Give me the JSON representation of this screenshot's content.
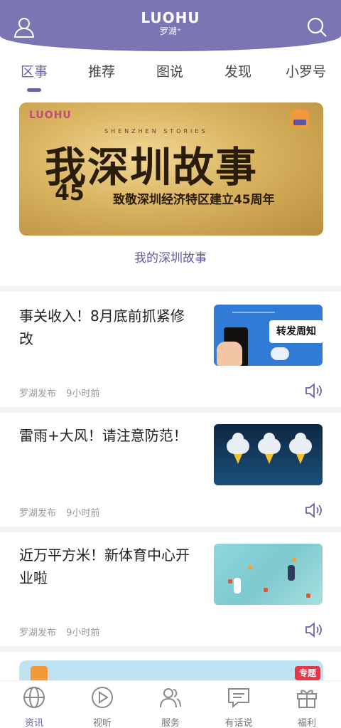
{
  "header": {
    "logo_mark": "LUOHU",
    "logo_sub": "罗湖⁺"
  },
  "tabs": [
    {
      "label": "区事",
      "active": true
    },
    {
      "label": "推荐",
      "active": false
    },
    {
      "label": "图说",
      "active": false
    },
    {
      "label": "发现",
      "active": false
    },
    {
      "label": "小罗号",
      "active": false
    }
  ],
  "banner": {
    "brand": "LUOHU",
    "en_text": "SHENZHEN STORIES",
    "title": "我深圳故事",
    "number": "45",
    "subtitle": "致敬深圳经济特区建立45周年",
    "caption": "我的深圳故事"
  },
  "news": [
    {
      "title": "事关收入！8月底前抓紧修改",
      "source": "罗湖发布",
      "time": "9小时前",
      "thumb_text": "转发周知"
    },
    {
      "title": "雷雨+大风！请注意防范！",
      "source": "罗湖发布",
      "time": "9小时前"
    },
    {
      "title": "近万平方米！新体育中心开业啦",
      "source": "罗湖发布",
      "time": "9小时前"
    }
  ],
  "partial_card": {
    "tag": "专题"
  },
  "bottom_nav": [
    {
      "label": "资讯",
      "icon": "globe-icon",
      "active": true
    },
    {
      "label": "视听",
      "icon": "play-icon",
      "active": false
    },
    {
      "label": "服务",
      "icon": "people-icon",
      "active": false
    },
    {
      "label": "有话说",
      "icon": "chat-icon",
      "active": false
    },
    {
      "label": "福利",
      "icon": "gift-icon",
      "active": false
    }
  ],
  "colors": {
    "brand": "#7b76b3",
    "accent": "#6a64a8",
    "meta": "#999999"
  }
}
